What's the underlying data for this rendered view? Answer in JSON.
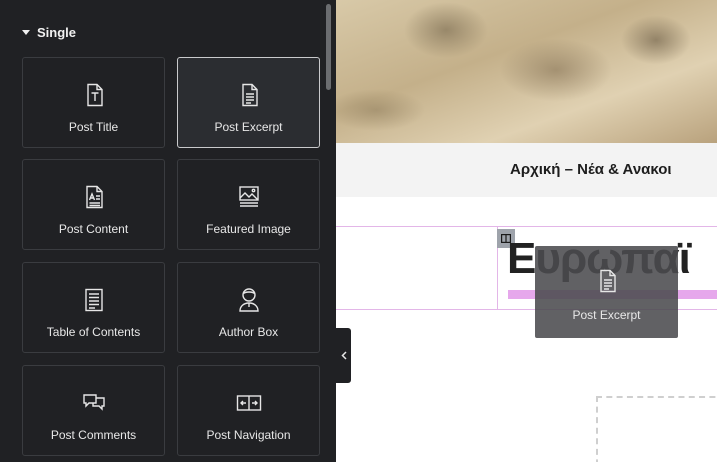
{
  "panel": {
    "section_title": "Single",
    "widgets": [
      {
        "label": "Post Title",
        "icon": "post-title-icon",
        "active": false
      },
      {
        "label": "Post Excerpt",
        "icon": "post-excerpt-icon",
        "active": true
      },
      {
        "label": "Post Content",
        "icon": "post-content-icon",
        "active": false
      },
      {
        "label": "Featured Image",
        "icon": "featured-image-icon",
        "active": false
      },
      {
        "label": "Table of Contents",
        "icon": "table-of-contents-icon",
        "active": false
      },
      {
        "label": "Author Box",
        "icon": "author-box-icon",
        "active": false
      },
      {
        "label": "Post Comments",
        "icon": "post-comments-icon",
        "active": false
      },
      {
        "label": "Post Navigation",
        "icon": "post-navigation-icon",
        "active": false
      }
    ]
  },
  "canvas": {
    "breadcrumb_text": "Αρχική – Νέα & Ανακοι",
    "heading_text": "Ευρωπαϊ",
    "drag_ghost_label": "Post Excerpt"
  },
  "colors": {
    "panel_bg": "#202124",
    "tile_border": "#3a3c40",
    "selection_pink": "#e3b6e8",
    "highlight": "#e6a8ec"
  }
}
